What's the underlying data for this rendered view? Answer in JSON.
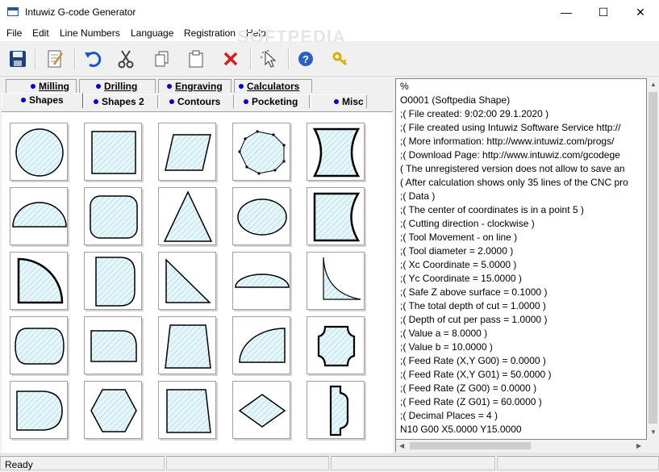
{
  "window": {
    "title": "Intuwiz G-code Generator",
    "minimize_glyph": "—",
    "maximize_glyph": "☐",
    "close_glyph": "✕"
  },
  "menu": [
    "File",
    "Edit",
    "Line Numbers",
    "Language",
    "Registration",
    "Help"
  ],
  "watermark": "SOFTPEDIA",
  "toolbar": {
    "icons": [
      "save-icon",
      "edit-document-icon",
      "undo-icon",
      "cut-icon",
      "copy-icon",
      "paste-icon",
      "delete-icon",
      "pointer-icon",
      "help-icon",
      "key-icon"
    ],
    "colors": {
      "save": "#1f3f7a",
      "undo": "#1a57c8",
      "delete": "#d42020",
      "help": "#2c5fc0",
      "key": "#d8b000"
    }
  },
  "tabs": {
    "back_row": [
      "Milling",
      "Drilling",
      "Engraving",
      "Calculators"
    ],
    "front_row": [
      "Shapes",
      "Shapes 2",
      "Contours",
      "Pocketing",
      "Misc"
    ],
    "selected": "Shapes"
  },
  "shapes": [
    "circle",
    "square",
    "parallelogram",
    "octagon",
    "concave-square",
    "semi-ellipse",
    "rounded-square",
    "triangle",
    "ellipse",
    "concave-right-rect",
    "quarter-circle",
    "d-shape",
    "right-triangle",
    "half-ellipse",
    "concave-triangle",
    "obround",
    "rounded-corner-rect",
    "trapezoid",
    "quarter-ellipse",
    "notched-cross",
    "d-shape-2",
    "hexagon",
    "slanted-rect",
    "rhombus",
    "slotted-bar"
  ],
  "shape_fill_color": "#e6f6fb",
  "shape_hatch_color": "#8fd0e8",
  "code_lines": [
    "%",
    "O0001    (Softpedia Shape)",
    ";( File created: 9:02:00  29.1.2020   )",
    ";( File created using Intuwiz Software Service http://",
    ";( More information: http://www.intuwiz.com/progs/",
    ";( Download Page: http://www.intuwiz.com/gcodege",
    "( The unregistered version does not allow to save an",
    "( After calculation shows only 35 lines of the CNC pro",
    ";( Data )",
    ";( The center of coordinates is in a point  5 )",
    ";( Cutting direction - clockwise )",
    ";( Tool Movement - on line )",
    ";( Tool diameter = 2.0000 )",
    ";( Xc Coordinate = 5.0000 )",
    ";( Yc Coordinate = 15.0000 )",
    ";( Safe Z above surface = 0.1000 )",
    ";( The total depth of cut = 1.0000 )",
    ";( Depth of cut per pass = 1.0000 )",
    ";( Value a = 8.0000 )",
    ";( Value b = 10.0000 )",
    ";( Feed Rate (X,Y G00) = 0.0000 )",
    ";( Feed Rate (X,Y G01) = 50.0000 )",
    ";( Feed Rate (Z G00) = 0.0000 )",
    ";( Feed Rate (Z G01) = 60.0000 )",
    ";( Decimal Places = 4 )",
    "N10  G00 X5.0000 Y15.0000"
  ],
  "status": {
    "text": "Ready"
  }
}
